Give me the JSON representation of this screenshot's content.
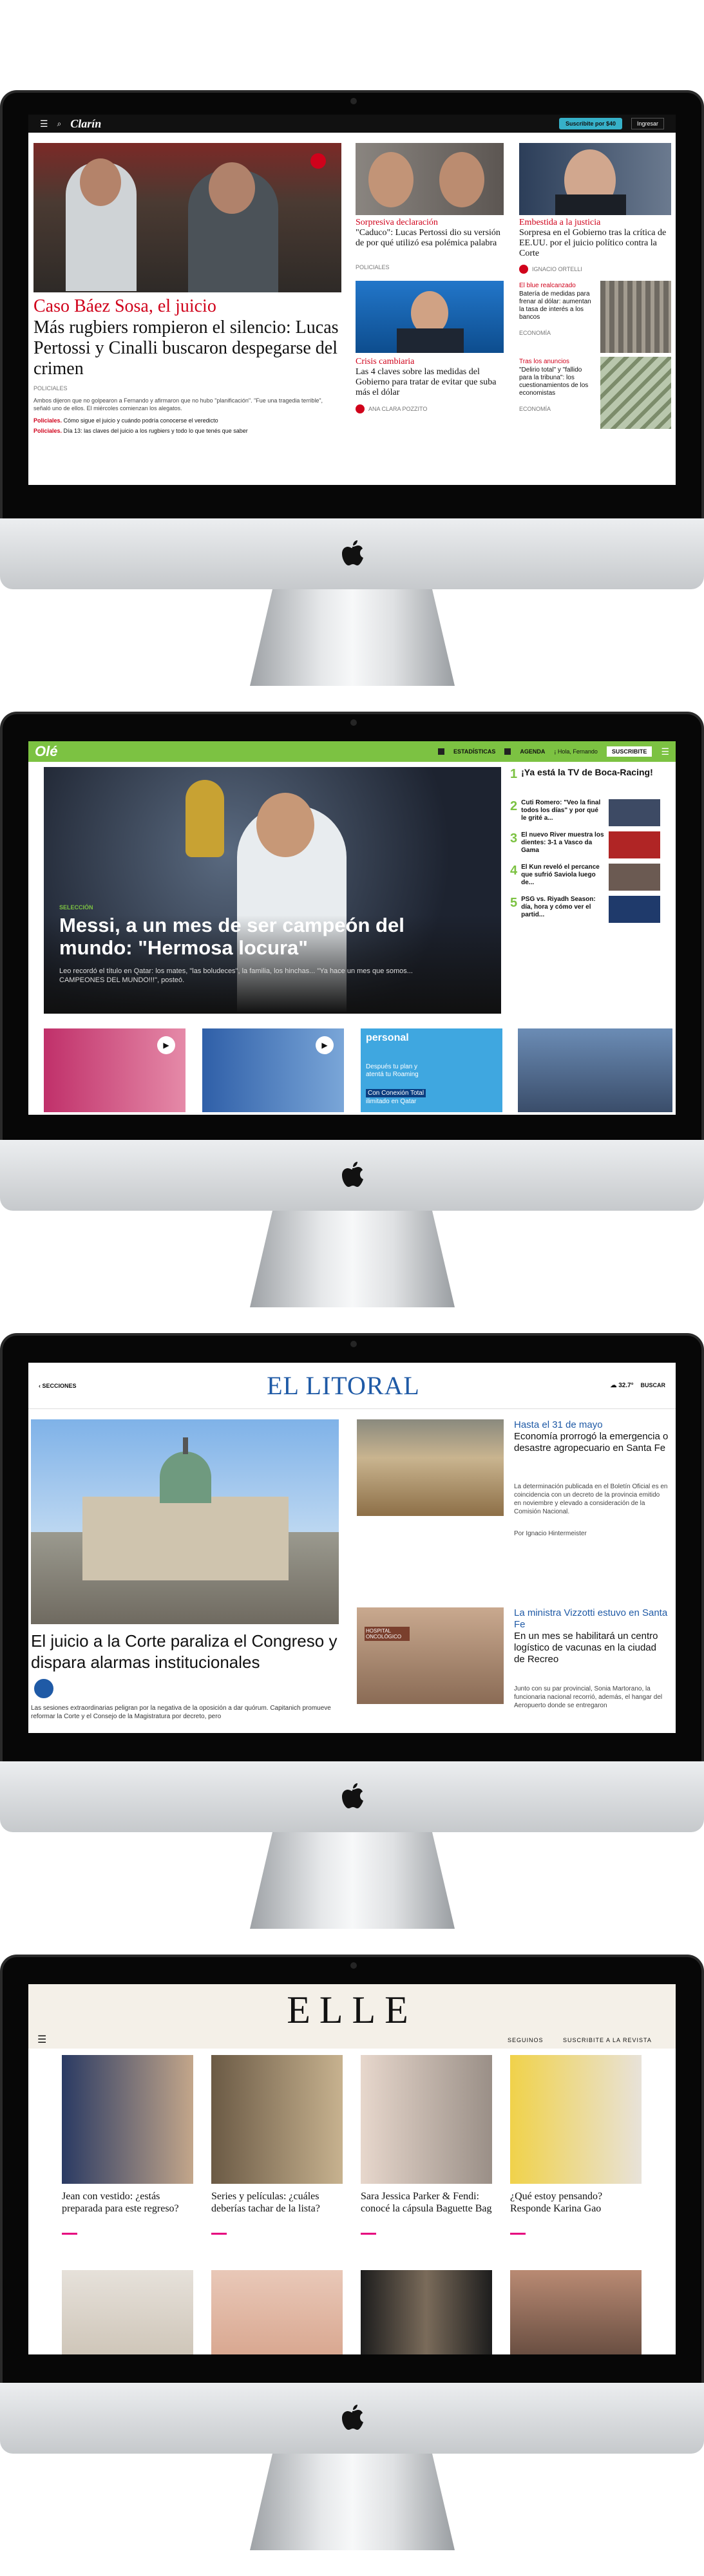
{
  "clarin": {
    "brand": "Clarín",
    "subscribe": "Suscribite por $40",
    "login": "Ingresar",
    "main_kicker": "Caso Báez Sosa, el juicio",
    "main_title": "Más rugbiers rompieron el silencio: Lucas Pertossi y Cinalli buscaron despegarse del crimen",
    "main_section": "POLICIALES",
    "main_summary": "Ambos dijeron que no golpearon a Fernando y afirmaron que no hubo \"planificación\". \"Fue una tragedia terrible\", señaló uno de ellos. El miércoles comienzan los alegatos.",
    "links": [
      {
        "tag": "Policiales.",
        "text": "Cómo sigue el juicio y cuándo podría conocerse el veredicto"
      },
      {
        "tag": "Policiales.",
        "text": "Día 13: las claves del juicio a los rugbiers y todo lo que tenés que saber"
      }
    ],
    "col2_kicker": "Sorpresiva declaración",
    "col2_title": "\"Caduco\": Lucas Pertossi dio su versión de por qué utilizó esa polémica palabra",
    "col2_section": "POLICIALES",
    "col3_kicker": "Embestida a la justicia",
    "col3_title": "Sorpresa en el Gobierno tras la crítica de EE.UU. por el juicio político contra la Corte",
    "col3_author": "IGNACIO ORTELLI",
    "blue_kicker": "El blue realcanzado",
    "blue_text": "Batería de medidas para frenar al dólar: aumentan la tasa de interés a los bancos",
    "blue_section": "ECONOMÍA",
    "crisis_kicker": "Crisis cambiaria",
    "crisis_title": "Las 4 claves sobre las medidas del Gobierno para tratar de evitar que suba más el dólar",
    "crisis_author": "ANA CLARA POZZITO",
    "anuncios_kicker": "Tras los anuncios",
    "anuncios_text": "\"Delirio total\" y \"fallido para la tribuna\": los cuestionamientos de los economistas",
    "anuncios_section": "ECONOMÍA"
  },
  "ole": {
    "brand": "Olé",
    "estadisticas": "ESTADÍSTICAS",
    "agenda": "AGENDA",
    "user": "¡ Hola, Fernando",
    "suscribite": "SUSCRIBITE",
    "kicker": "SELECCIÓN",
    "title": "Messi, a un mes de ser campeón del mundo: \"Hermosa locura\"",
    "summary": "Leo recordó el título en Qatar: los mates, \"las boludeces\", la familia, los hinchas... \"Ya hace un mes que somos... CAMPEONES DEL MUNDO!!!\", posteó.",
    "ranking": [
      {
        "n": "1",
        "t": "¡Ya está la TV de Boca-Racing!"
      },
      {
        "n": "2",
        "t": "Cuti Romero: \"Veo la final todos los días\" y por qué le grité a..."
      },
      {
        "n": "3",
        "t": "El nuevo River muestra los dientes: 3-1 a Vasco da Gama"
      },
      {
        "n": "4",
        "t": "El Kun reveló el percance que sufrió Saviola luego de..."
      },
      {
        "n": "5",
        "t": "PSG vs. Riyadh Season: día, hora y cómo ver el partid..."
      }
    ],
    "ad_brand": "personal",
    "ad_line1": "Después tu plan y",
    "ad_line2": "atentá tu Roaming",
    "ad_line3": "Con Conexión Total",
    "ad_line4": "ilimitado en Qatar"
  },
  "litoral": {
    "secciones": "SECCIONES",
    "brand": "EL LITORAL",
    "temp": "32.7°",
    "buscar": "BUSCAR",
    "main_title": "El juicio a la Corte paraliza el Congreso y dispara alarmas institucionales",
    "main_summary": "Las sesiones extraordinarias peligran por la negativa de la oposición a dar quórum. Capitanich promueve reformar la Corte y el Consejo de la Magistratura por decreto, pero",
    "n1_kicker": "Hasta el 31 de mayo",
    "n1_title": "Economía prorrogó la emergencia o desastre agropecuario en Santa Fe",
    "n1_text": "La determinación publicada en el Boletín Oficial es en coincidencia con un decreto de la provincia emitido en noviembre y elevado a consideración de la Comisión Nacional.",
    "n1_author": "Por Ignacio Hintermeister",
    "n2_kicker": "La ministra Vizzotti estuvo en Santa Fe",
    "n2_title": "En un mes se habilitará un centro logístico de vacunas en la ciudad de Recreo",
    "n2_text": "Junto con su par provincial, Sonia Martorano, la funcionaria nacional recorrió, además, el hangar del Aeropuerto donde se entregaron",
    "sign": "HOSPITAL ONCOLÓGICO"
  },
  "elle": {
    "brand": "ELLE",
    "seguinos": "SEGUINOS",
    "suscribite": "SUSCRIBITE A LA REVISTA",
    "cards": [
      "Jean con vestido: ¿estás preparada para este regreso?",
      "Series y películas: ¿cuáles deberías tachar de la lista?",
      "Sara Jessica Parker & Fendi: conocé la cápsula Baguette Bag",
      "¿Qué estoy pensando? Responde Karina Gao"
    ]
  },
  "colors": {
    "clarin_red": "#d0021b",
    "ole_green": "#7cc242",
    "litoral_blue": "#1f5aa6",
    "elle_pink": "#e6007e"
  }
}
